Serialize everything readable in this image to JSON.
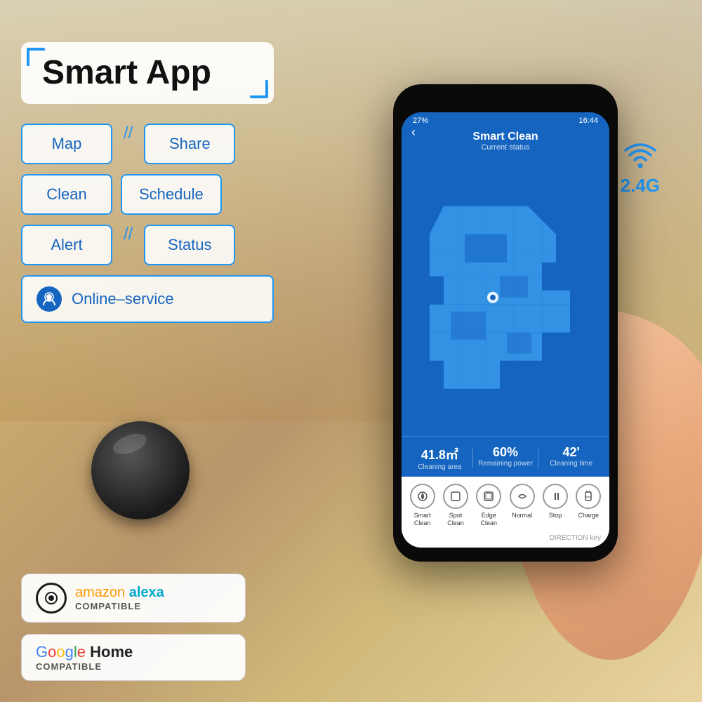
{
  "background": {
    "color": "#c8a96e"
  },
  "header": {
    "title": "Smart App"
  },
  "features": {
    "row1": [
      "Map",
      "Share"
    ],
    "row2": [
      "Clean",
      "Schedule"
    ],
    "row3": [
      "Alert",
      "Status"
    ],
    "row4": "Online–service"
  },
  "clean_schedule": "Clean Schedule",
  "wifi": {
    "label": "2.4G"
  },
  "phone": {
    "status_bar": {
      "battery": "27%",
      "time": "16:44"
    },
    "header": {
      "title": "Smart Clean",
      "subtitle": "Current status"
    },
    "stats": {
      "area_value": "41.8㎡",
      "area_label": "Cleaning area",
      "power_value": "60%",
      "power_label": "Remaining power",
      "time_value": "42'",
      "time_label": "Cleaning time"
    },
    "controls": {
      "smart_clean": "Smart\nClean",
      "spot_clean": "Spot\nClean",
      "edge_clean": "Edge\nClean",
      "normal": "Normal",
      "stop": "Stop",
      "charge": "Charge"
    },
    "direction": "DIRECTION key"
  },
  "alexa": {
    "brand": "amazon",
    "product": "alexa",
    "compatible": "COMPATIBLE"
  },
  "google_home": {
    "brand": "Google Home",
    "compatible": "COMPATIBLE"
  },
  "buttons": {
    "map": "Map",
    "share": "Share",
    "clean": "Clean",
    "schedule": "Schedule",
    "alert": "Alert",
    "status": "Status",
    "online_service": "Online–service"
  }
}
